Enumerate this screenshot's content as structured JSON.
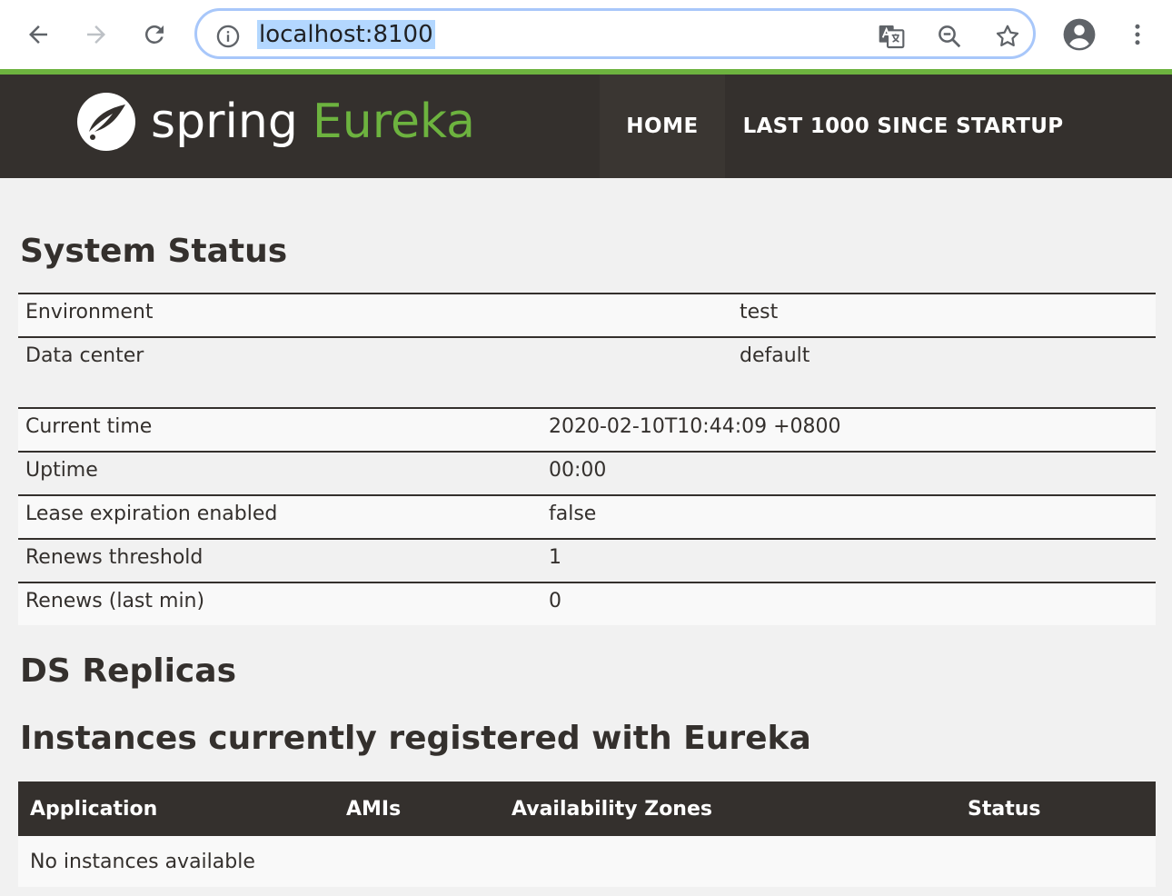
{
  "browser": {
    "url": "localhost:8100",
    "icons": {
      "back": "arrow-left-icon",
      "forward": "arrow-right-icon",
      "reload": "reload-icon",
      "info": "info-icon",
      "translate": "translate-icon",
      "zoom": "zoom-out-icon",
      "bookmark": "star-icon",
      "profile": "account-icon",
      "menu": "kebab-menu-icon"
    }
  },
  "colors": {
    "brand_green": "#6db33f",
    "header_dark": "#34302d",
    "page_bg": "#f1f1f1"
  },
  "header": {
    "logo_spring": "spring",
    "logo_eureka": "Eureka",
    "nav": {
      "home": "HOME",
      "last": "LAST 1000 SINCE STARTUP"
    }
  },
  "system_status": {
    "title": "System Status",
    "rows_a": [
      {
        "label": "Environment",
        "value": "test"
      },
      {
        "label": "Data center",
        "value": "default"
      }
    ],
    "rows_b": [
      {
        "label": "Current time",
        "value": "2020-02-10T10:44:09 +0800"
      },
      {
        "label": "Uptime",
        "value": "00:00"
      },
      {
        "label": "Lease expiration enabled",
        "value": "false"
      },
      {
        "label": "Renews threshold",
        "value": "1"
      },
      {
        "label": "Renews (last min)",
        "value": "0"
      }
    ]
  },
  "ds_replicas": {
    "title": "DS Replicas"
  },
  "instances": {
    "title": "Instances currently registered with Eureka",
    "columns": [
      "Application",
      "AMIs",
      "Availability Zones",
      "Status"
    ],
    "empty_message": "No instances available"
  }
}
